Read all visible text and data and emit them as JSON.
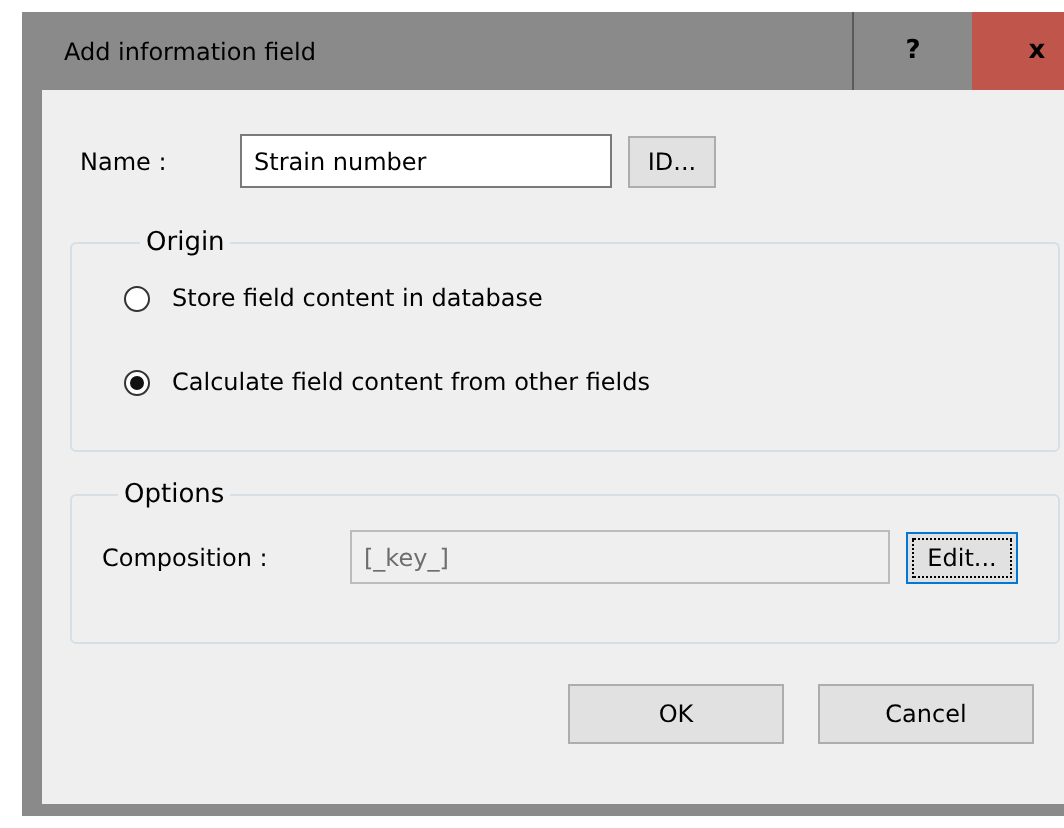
{
  "window": {
    "title": "Add information field",
    "help": "?",
    "close": "x"
  },
  "name": {
    "label": "Name :",
    "value": "Strain number",
    "button": "ID..."
  },
  "origin": {
    "title": "Origin",
    "options": [
      {
        "label": "Store field content in database",
        "selected": false
      },
      {
        "label": "Calculate field content from other fields",
        "selected": true
      }
    ]
  },
  "options": {
    "title": "Options",
    "composition_label": "Composition :",
    "composition_value": "[_key_]",
    "composition_disabled": true,
    "edit_button": "Edit..."
  },
  "buttons": [
    "OK",
    "Cancel"
  ]
}
